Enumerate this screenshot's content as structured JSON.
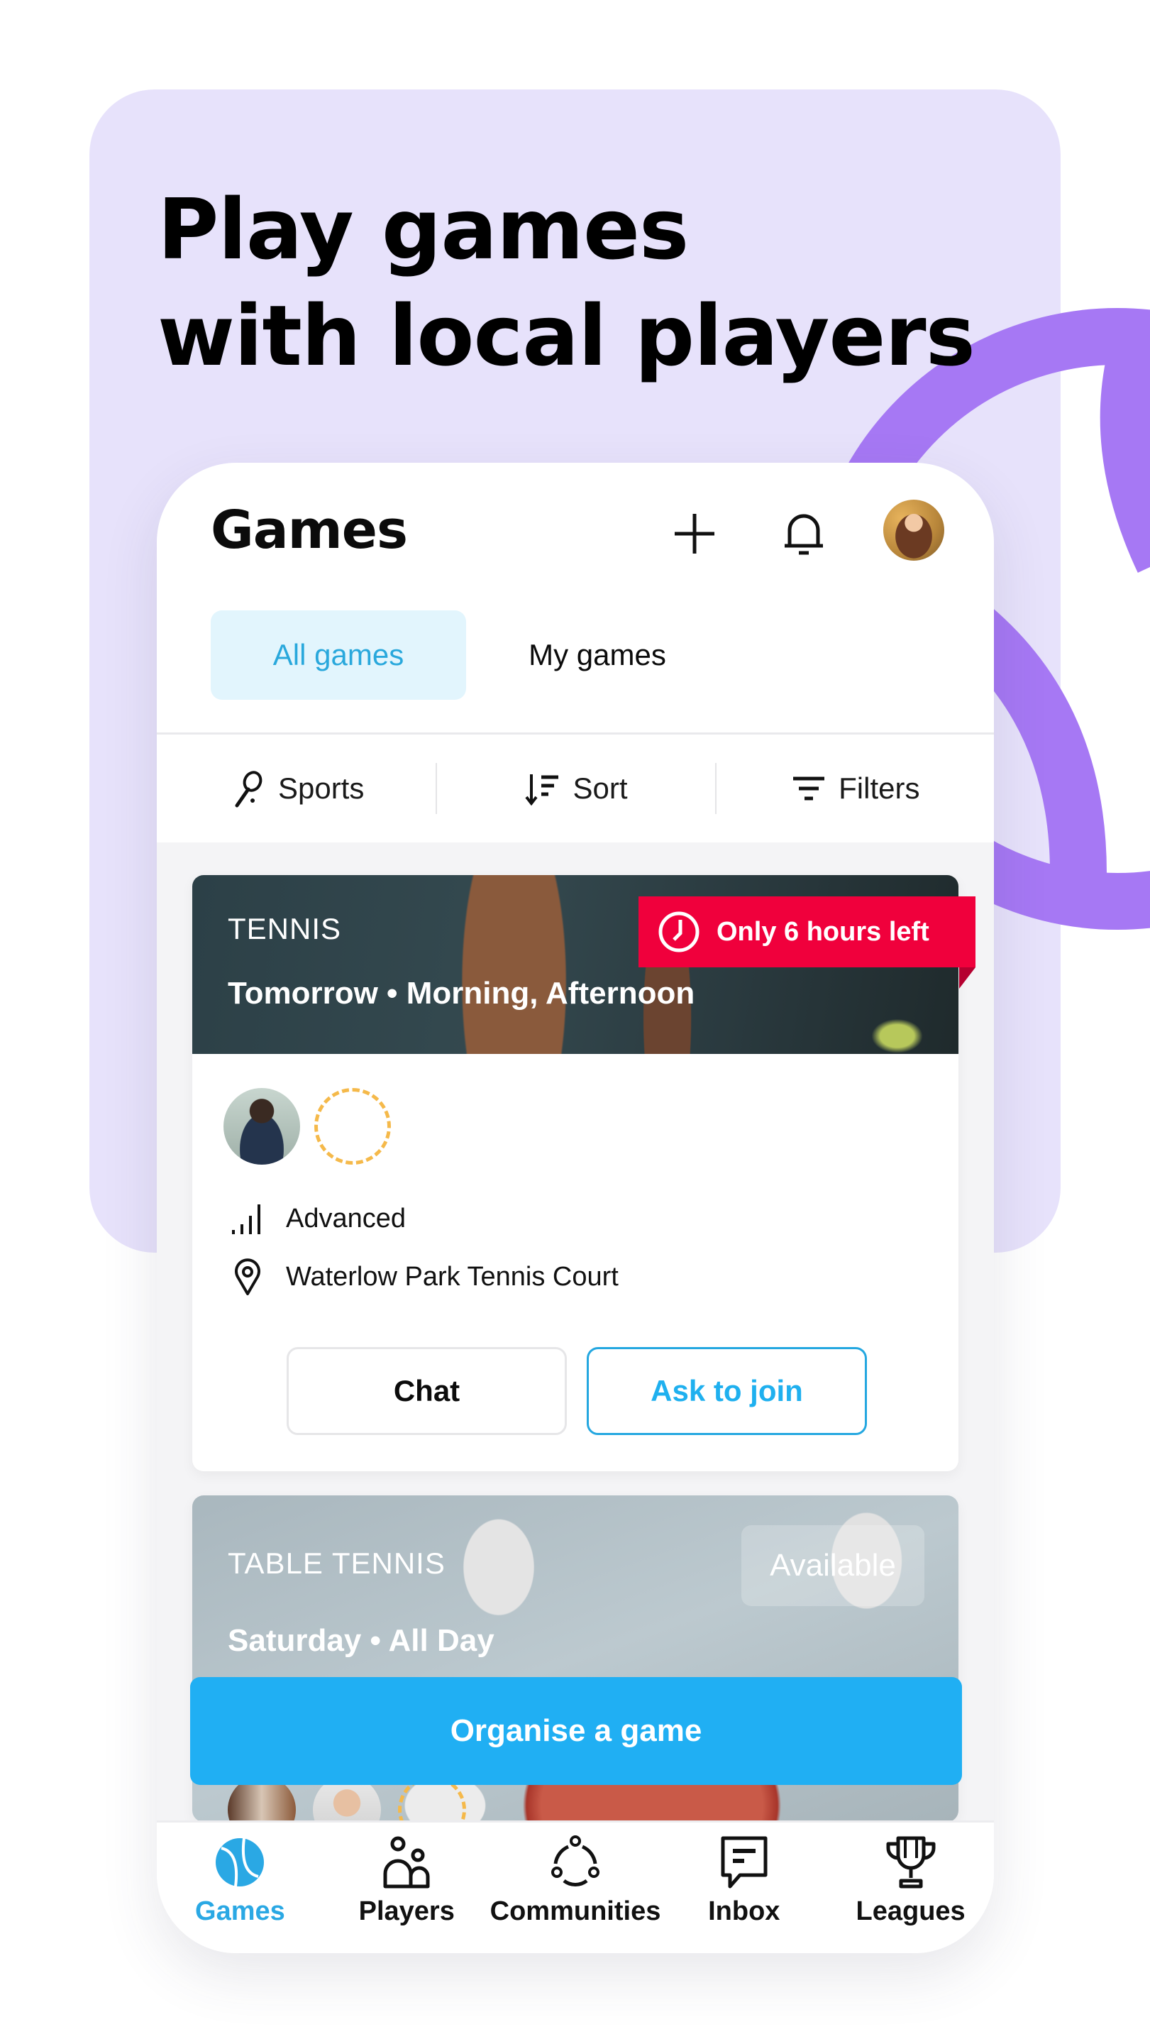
{
  "promo": {
    "headline_line1": "Play games",
    "headline_line2": "with local players",
    "background_color": "#e7e2fb",
    "accent_color": "#a678f4"
  },
  "header": {
    "title": "Games",
    "add_icon": "plus-icon",
    "notifications_icon": "bell-icon",
    "profile_icon": "user-avatar"
  },
  "tabs": [
    {
      "label": "All games",
      "active": true
    },
    {
      "label": "My games",
      "active": false
    }
  ],
  "filter_bar": [
    {
      "label": "Sports",
      "icon": "racket-icon"
    },
    {
      "label": "Sort",
      "icon": "sort-icon"
    },
    {
      "label": "Filters",
      "icon": "filter-icon"
    }
  ],
  "games": [
    {
      "sport": "TENNIS",
      "when": "Tomorrow • Morning, Afternoon",
      "badge": "Only 6 hours left",
      "badge_color": "#f0003c",
      "players_joined": 1,
      "open_slots": 1,
      "level": "Advanced",
      "location": "Waterlow Park Tennis Court",
      "actions": {
        "chat": "Chat",
        "join": "Ask to join"
      }
    },
    {
      "sport": "TABLE TENNIS",
      "when": "Saturday • All Day",
      "badge": "Available",
      "players_joined": 2,
      "open_slots": 1
    }
  ],
  "primary_action": {
    "label": "Organise a game",
    "color": "#20aff3"
  },
  "bottom_nav": [
    {
      "label": "Games",
      "icon": "tennis-ball-icon",
      "active": true
    },
    {
      "label": "Players",
      "icon": "players-icon",
      "active": false
    },
    {
      "label": "Communities",
      "icon": "communities-icon",
      "active": false
    },
    {
      "label": "Inbox",
      "icon": "inbox-icon",
      "active": false
    },
    {
      "label": "Leagues",
      "icon": "trophy-icon",
      "active": false
    }
  ]
}
